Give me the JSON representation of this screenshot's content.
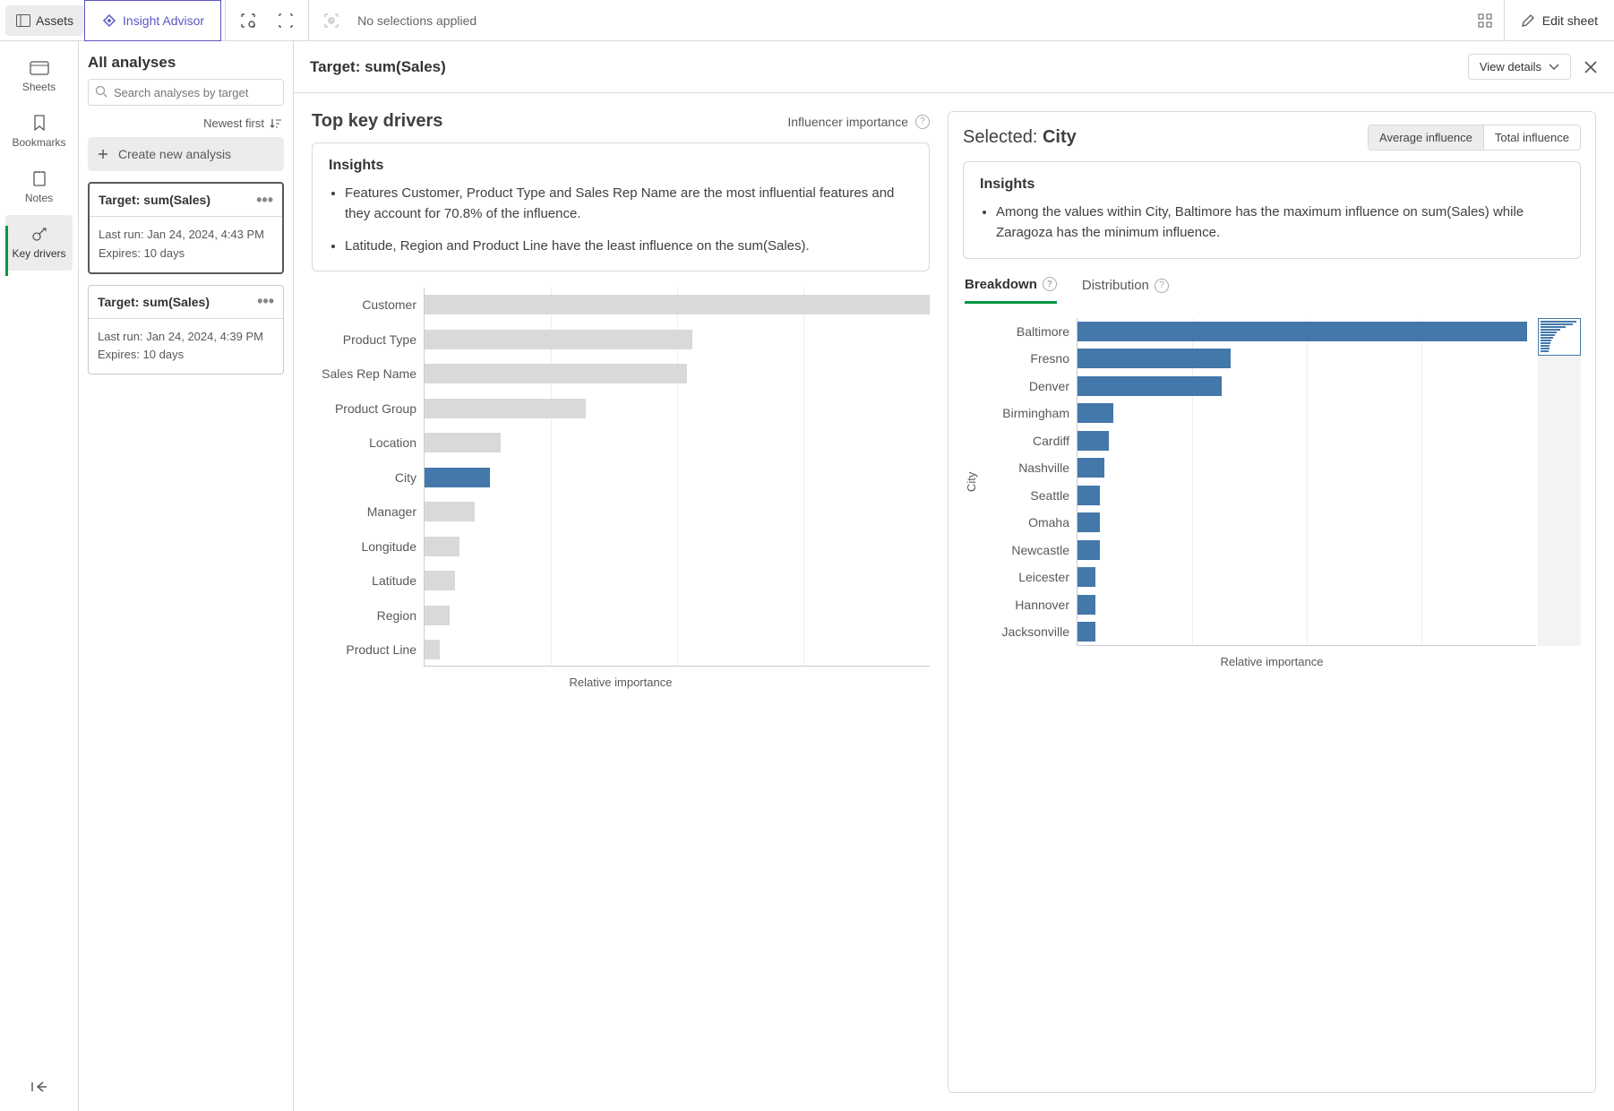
{
  "topbar": {
    "assets_label": "Assets",
    "insight_label": "Insight Advisor",
    "status": "No selections applied",
    "edit_label": "Edit sheet"
  },
  "rail": {
    "sheets": "Sheets",
    "bookmarks": "Bookmarks",
    "notes": "Notes",
    "keydrivers": "Key drivers"
  },
  "analyses": {
    "title": "All analyses",
    "search_placeholder": "Search analyses by target",
    "sort_label": "Newest first",
    "create_label": "Create new analysis",
    "cards": [
      {
        "title": "Target: sum(Sales)",
        "last": "Last run: Jan 24, 2024, 4:43 PM",
        "exp": "Expires: 10 days",
        "selected": true
      },
      {
        "title": "Target: sum(Sales)",
        "last": "Last run: Jan 24, 2024, 4:39 PM",
        "exp": "Expires: 10 days",
        "selected": false
      }
    ]
  },
  "main": {
    "target": "Target: sum(Sales)",
    "view_details": "View details"
  },
  "left": {
    "title": "Top key drivers",
    "sub": "Influencer importance",
    "insights_h": "Insights",
    "insights": [
      "Features Customer, Product Type and Sales Rep Name are the most influential features and they account for 70.8% of the influence.",
      "Latitude, Region and Product Line have the least influence on the sum(Sales)."
    ],
    "xlabel": "Relative importance"
  },
  "right": {
    "selected_prefix": "Selected: ",
    "selected_value": "City",
    "seg_avg": "Average influence",
    "seg_total": "Total influence",
    "insights_h": "Insights",
    "insight": "Among the values within City, Baltimore has the maximum influence on sum(Sales) while Zaragoza has the minimum influence.",
    "tab_breakdown": "Breakdown",
    "tab_distribution": "Distribution",
    "ylabel": "City",
    "xlabel": "Relative importance"
  },
  "chart_data": [
    {
      "type": "bar",
      "orientation": "horizontal",
      "title": "Top key drivers",
      "xlabel": "Relative importance",
      "categories": [
        "Customer",
        "Product Type",
        "Sales Rep Name",
        "Product Group",
        "Location",
        "City",
        "Manager",
        "Longitude",
        "Latitude",
        "Region",
        "Product Line"
      ],
      "values": [
        100,
        53,
        52,
        32,
        15,
        13,
        10,
        7,
        6,
        5,
        3
      ],
      "highlight": "City",
      "xlim": [
        0,
        100
      ]
    },
    {
      "type": "bar",
      "orientation": "horizontal",
      "title": "Breakdown — City",
      "ylabel": "City",
      "xlabel": "Relative importance",
      "categories": [
        "Baltimore",
        "Fresno",
        "Denver",
        "Birmingham",
        "Cardiff",
        "Nashville",
        "Seattle",
        "Omaha",
        "Newcastle",
        "Leicester",
        "Hannover",
        "Jacksonville"
      ],
      "values": [
        100,
        34,
        32,
        8,
        7,
        6,
        5,
        5,
        5,
        4,
        4,
        4
      ],
      "xlim": [
        0,
        100
      ]
    }
  ]
}
